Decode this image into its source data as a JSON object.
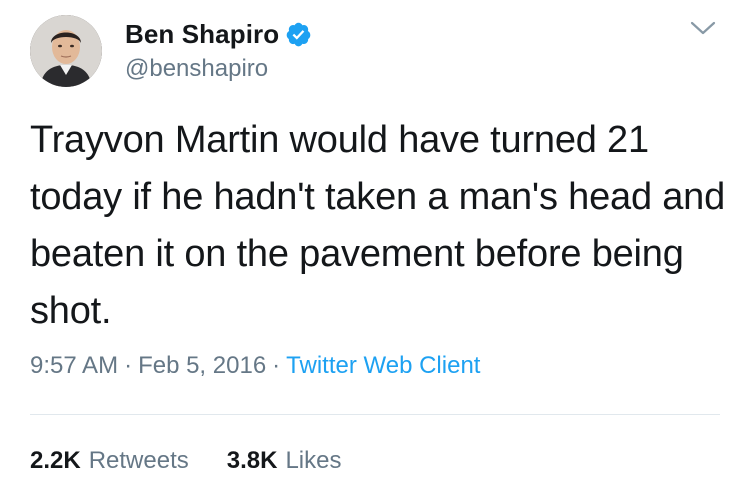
{
  "author": {
    "display_name": "Ben Shapiro",
    "handle": "@benshapiro",
    "verified": true,
    "avatar_icon": "profile-photo",
    "verified_icon": "verified-badge-icon"
  },
  "tweet": {
    "text": "Trayvon Martin would have turned 21 today if he hadn't taken a man's head and beaten it on the pavement before being shot.",
    "time": "9:57 AM",
    "separator": "·",
    "date": "Feb 5, 2016",
    "client": "Twitter Web Client"
  },
  "stats": {
    "retweets_count": "2.2K",
    "retweets_label": "Retweets",
    "likes_count": "3.8K",
    "likes_label": "Likes"
  },
  "colors": {
    "text_primary": "#14171a",
    "text_secondary": "#657786",
    "accent": "#1da1f2",
    "divider": "#e1e8ed"
  }
}
